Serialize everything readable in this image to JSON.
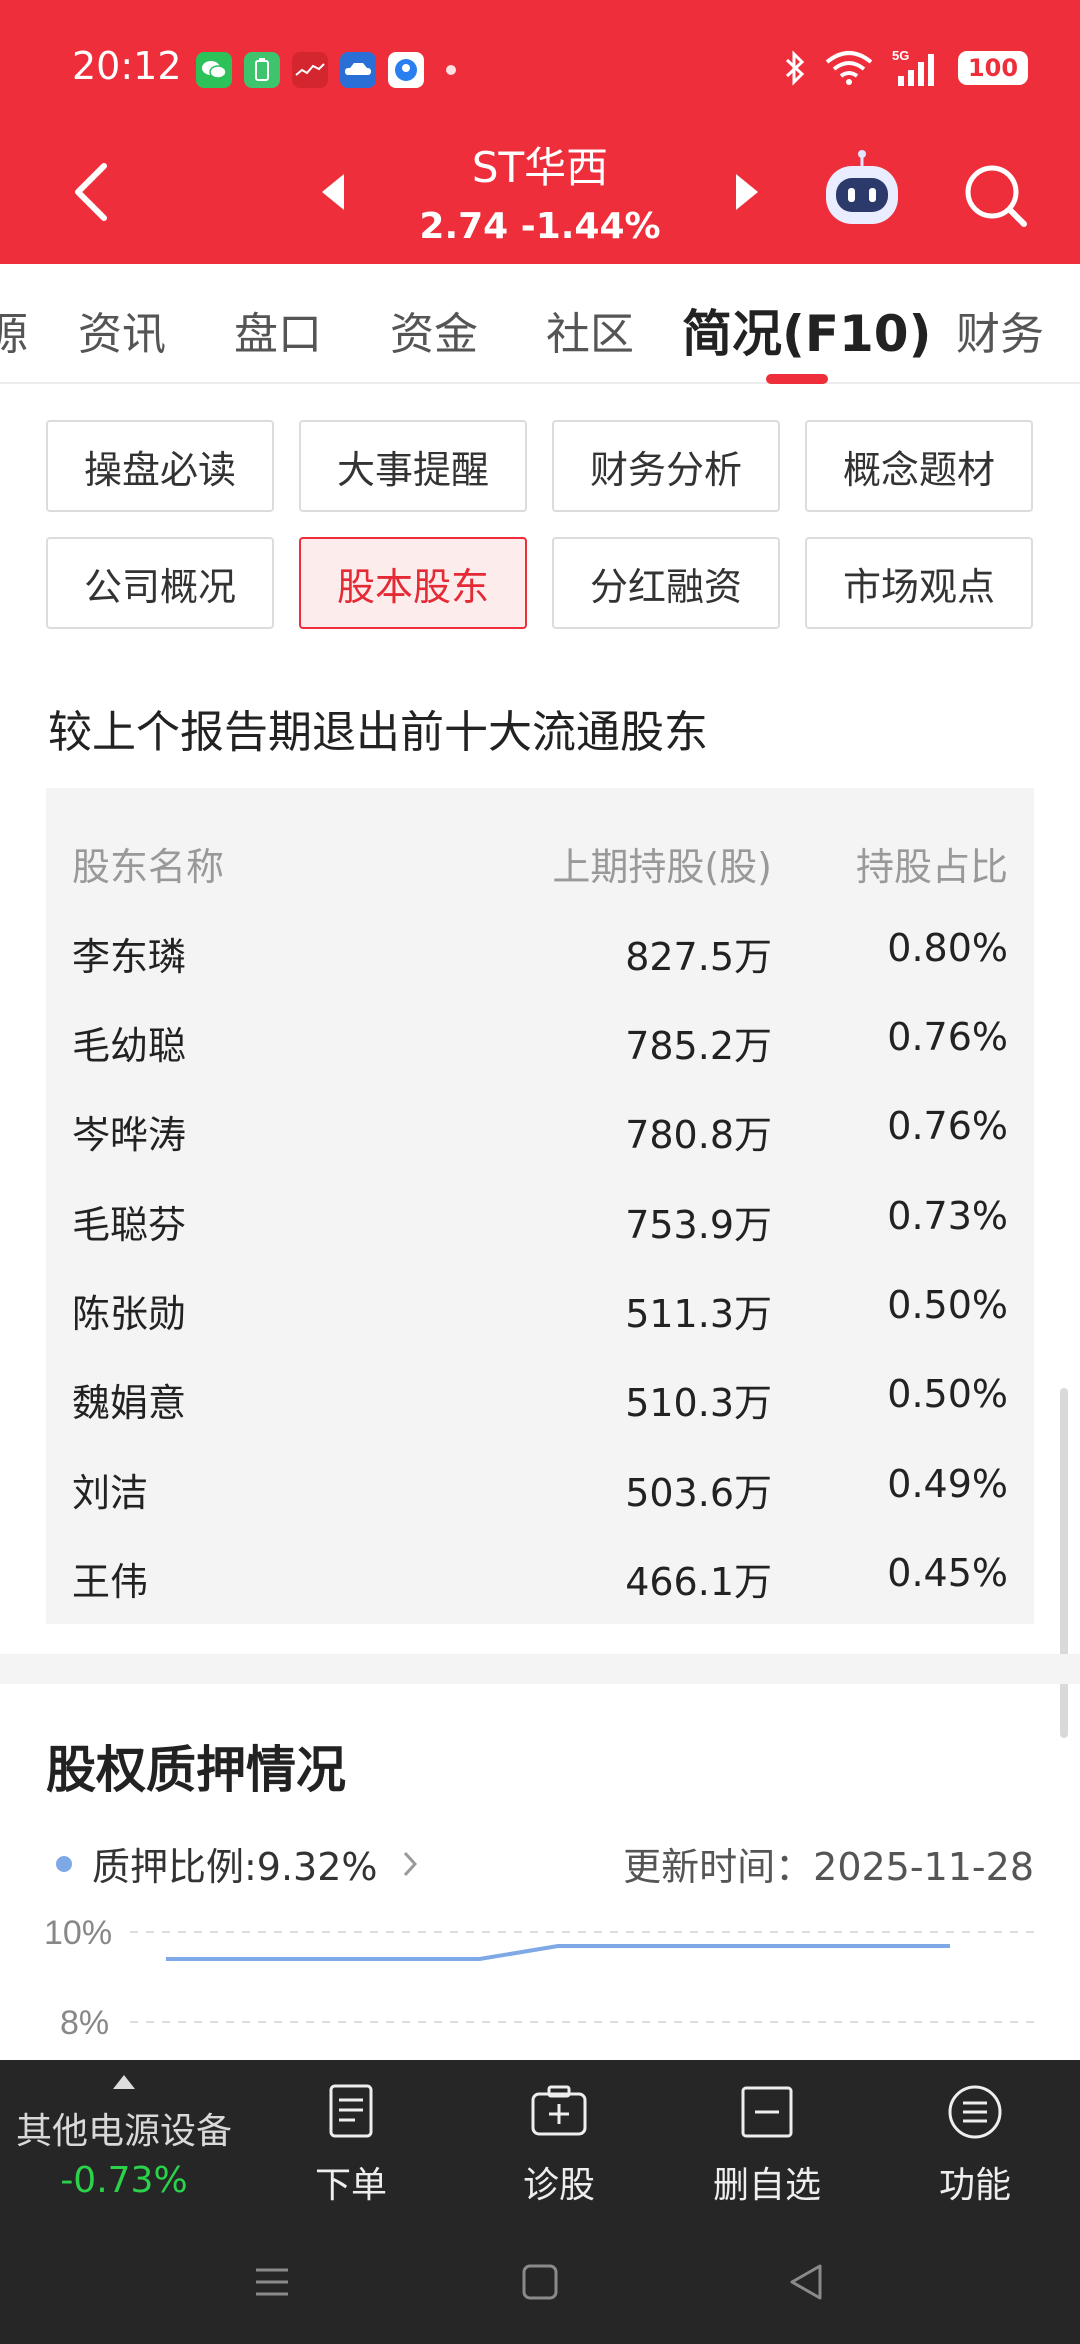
{
  "status": {
    "time": "20:12",
    "battery": "100",
    "signal": "5G"
  },
  "header": {
    "stock_name": "ST华西",
    "quote": "2.74  -1.44%"
  },
  "tabs": [
    {
      "label": "源"
    },
    {
      "label": "资讯"
    },
    {
      "label": "盘口"
    },
    {
      "label": "资金"
    },
    {
      "label": "社区"
    },
    {
      "label": "简况(F10)"
    },
    {
      "label": "财务"
    }
  ],
  "quick_buttons": [
    {
      "label": "操盘必读"
    },
    {
      "label": "大事提醒"
    },
    {
      "label": "财务分析"
    },
    {
      "label": "概念题材"
    },
    {
      "label": "公司概况"
    },
    {
      "label": "股本股东"
    },
    {
      "label": "分红融资"
    },
    {
      "label": "市场观点"
    }
  ],
  "shareholders": {
    "title": "较上个报告期退出前十大流通股东",
    "headers": {
      "name": "股东名称",
      "shares": "上期持股(股)",
      "ratio": "持股占比"
    },
    "rows": [
      {
        "name": "李东璘",
        "shares": "827.5万",
        "ratio": "0.80%"
      },
      {
        "name": "毛幼聪",
        "shares": "785.2万",
        "ratio": "0.76%"
      },
      {
        "name": "岑晔涛",
        "shares": "780.8万",
        "ratio": "0.76%"
      },
      {
        "name": "毛聪芬",
        "shares": "753.9万",
        "ratio": "0.73%"
      },
      {
        "name": "陈张勋",
        "shares": "511.3万",
        "ratio": "0.50%"
      },
      {
        "name": "魏娟意",
        "shares": "510.3万",
        "ratio": "0.50%"
      },
      {
        "name": "刘洁",
        "shares": "503.6万",
        "ratio": "0.49%"
      },
      {
        "name": "王伟",
        "shares": "466.1万",
        "ratio": "0.45%"
      }
    ]
  },
  "pledge": {
    "title": "股权质押情况",
    "legend": "质押比例:9.32%",
    "update": "更新时间：2025-11-28",
    "ticks": [
      "10%",
      "8%"
    ],
    "line_color": "#7ea9e6",
    "series_level": [
      0,
      0,
      0,
      0,
      0,
      1,
      1,
      1,
      1,
      1,
      1
    ]
  },
  "toolbar": {
    "index_name": "其他电源设备",
    "index_change": "-0.73%",
    "items": [
      {
        "label": "下单",
        "icon": "order-icon"
      },
      {
        "label": "诊股",
        "icon": "diagnose-icon"
      },
      {
        "label": "删自选",
        "icon": "remove-watchlist-icon"
      },
      {
        "label": "功能",
        "icon": "menu-icon"
      }
    ]
  }
}
